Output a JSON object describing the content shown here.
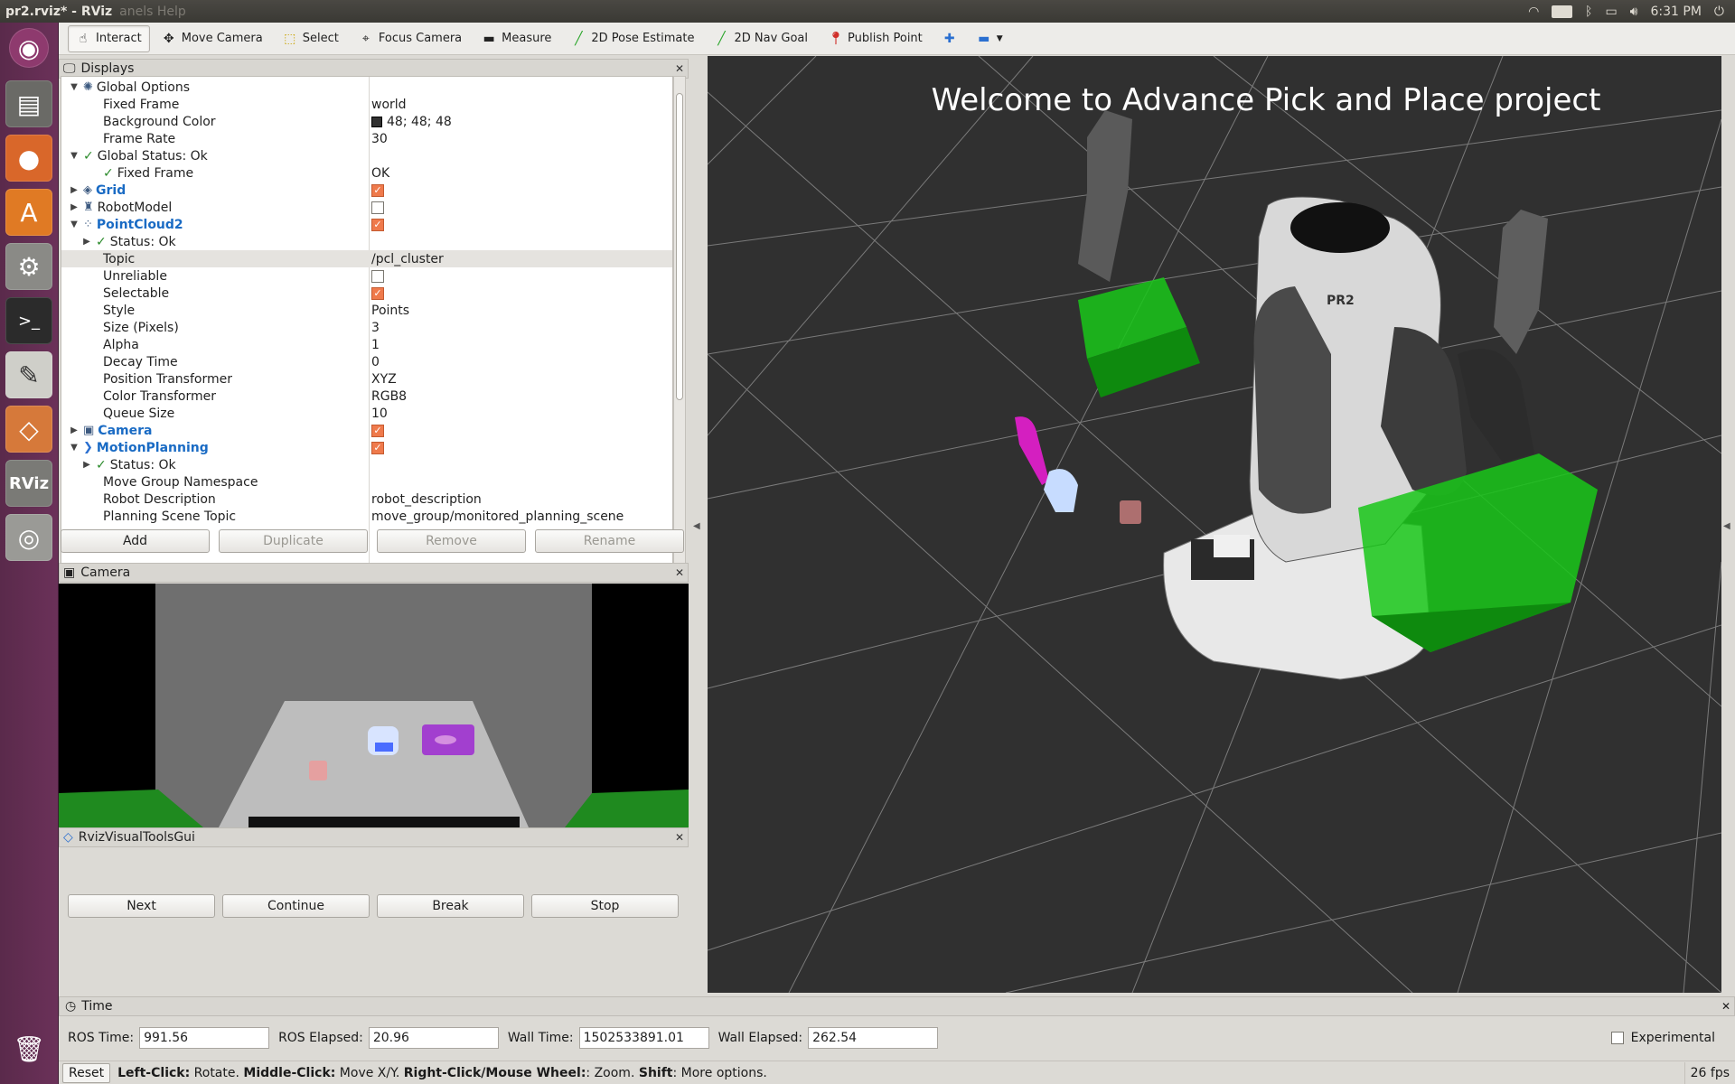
{
  "window": {
    "title": "pr2.rviz* - RViz",
    "menu_ghost": "anels   Help"
  },
  "tray": {
    "lang": "En",
    "clock": "6:31 PM"
  },
  "toolbar": {
    "tools": [
      {
        "label": "Interact",
        "icon": "hand-icon"
      },
      {
        "label": "Move Camera",
        "icon": "move-camera-icon"
      },
      {
        "label": "Select",
        "icon": "select-icon"
      },
      {
        "label": "Focus Camera",
        "icon": "focus-icon"
      },
      {
        "label": "Measure",
        "icon": "ruler-icon"
      },
      {
        "label": "2D Pose Estimate",
        "icon": "green-arrow-icon"
      },
      {
        "label": "2D Nav Goal",
        "icon": "green-arrow-icon"
      },
      {
        "label": "Publish Point",
        "icon": "pin-icon"
      }
    ]
  },
  "displays": {
    "title": "Displays",
    "rows": [
      {
        "label": "Global Options",
        "value": ""
      },
      {
        "label": "Fixed Frame",
        "value": "world"
      },
      {
        "label": "Background Color",
        "value": "48; 48; 48"
      },
      {
        "label": "Frame Rate",
        "value": "30"
      },
      {
        "label": "Global Status: Ok",
        "value": ""
      },
      {
        "label": "Fixed Frame",
        "value": "OK"
      },
      {
        "label": "Grid",
        "value": ""
      },
      {
        "label": "RobotModel",
        "value": ""
      },
      {
        "label": "PointCloud2",
        "value": ""
      },
      {
        "label": "Status: Ok",
        "value": ""
      },
      {
        "label": "Topic",
        "value": "/pcl_cluster"
      },
      {
        "label": "Unreliable",
        "value": ""
      },
      {
        "label": "Selectable",
        "value": ""
      },
      {
        "label": "Style",
        "value": "Points"
      },
      {
        "label": "Size (Pixels)",
        "value": "3"
      },
      {
        "label": "Alpha",
        "value": "1"
      },
      {
        "label": "Decay Time",
        "value": "0"
      },
      {
        "label": "Position Transformer",
        "value": "XYZ"
      },
      {
        "label": "Color Transformer",
        "value": "RGB8"
      },
      {
        "label": "Queue Size",
        "value": "10"
      },
      {
        "label": "Camera",
        "value": ""
      },
      {
        "label": "MotionPlanning",
        "value": ""
      },
      {
        "label": "Status: Ok",
        "value": ""
      },
      {
        "label": "Move Group Namespace",
        "value": ""
      },
      {
        "label": "Robot Description",
        "value": "robot_description"
      },
      {
        "label": "Planning Scene Topic",
        "value": "move_group/monitored_planning_scene"
      }
    ],
    "checks": {
      "grid": true,
      "robotmodel": false,
      "pointcloud2": true,
      "unreliable": false,
      "selectable": true,
      "camera": true,
      "motionplanning": true
    },
    "buttons": {
      "add": "Add",
      "duplicate": "Duplicate",
      "remove": "Remove",
      "rename": "Rename"
    }
  },
  "camera_panel": {
    "title": "Camera"
  },
  "rvt_panel": {
    "title": "RvizVisualToolsGui",
    "buttons": {
      "next": "Next",
      "continue": "Continue",
      "break": "Break",
      "stop": "Stop"
    }
  },
  "view3d": {
    "overlay_text": "Welcome  to  Advance  Pick  and  Place  project",
    "robot_label": "PR2",
    "bg_color": "#303030"
  },
  "time_panel": {
    "title": "Time",
    "ros_time_label": "ROS Time:",
    "ros_time": "991.56",
    "ros_elapsed_label": "ROS Elapsed:",
    "ros_elapsed": "20.96",
    "wall_time_label": "Wall Time:",
    "wall_time": "1502533891.01",
    "wall_elapsed_label": "Wall Elapsed:",
    "wall_elapsed": "262.54",
    "experimental_label": "Experimental"
  },
  "statusbar": {
    "reset": "Reset",
    "k1": "Left-Click:",
    "t1": " Rotate. ",
    "k2": "Middle-Click:",
    "t2": " Move X/Y. ",
    "k3": "Right-Click/Mouse Wheel:",
    "t3": ": Zoom. ",
    "k4": "Shift",
    "t4": ": More options.",
    "fps": "26 fps"
  }
}
